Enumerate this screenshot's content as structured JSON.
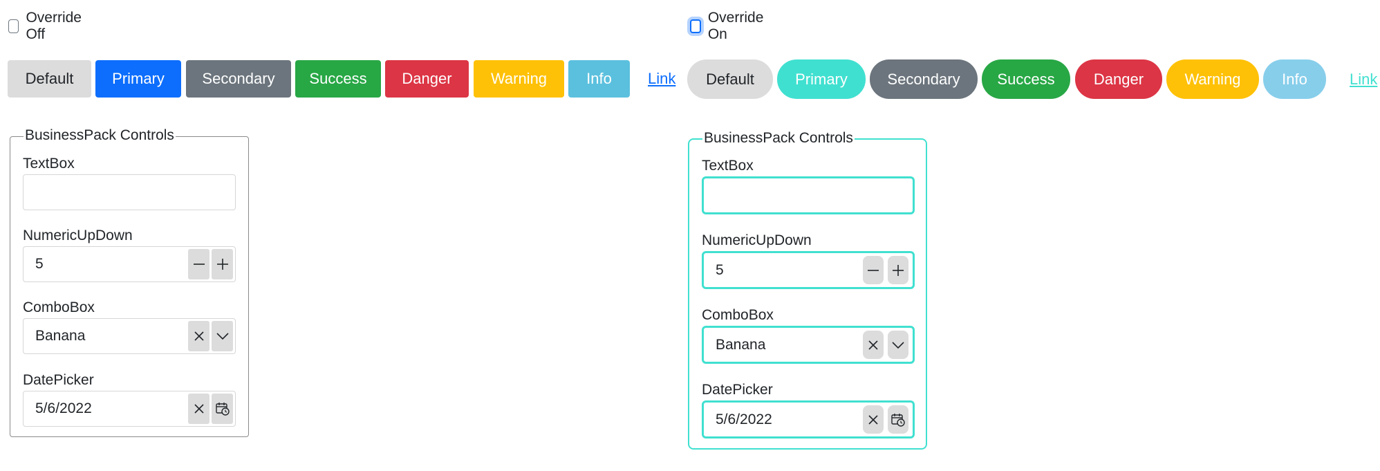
{
  "colors": {
    "default": "#dcdcdc",
    "primary": "#0d6efd",
    "primary_override": "#40e0d0",
    "secondary": "#6c757d",
    "success": "#28a745",
    "danger": "#dc3545",
    "warning": "#ffc107",
    "info": "#5bc0de",
    "info_override": "#87ceeb",
    "link": "#0d6efd",
    "link_override": "#40e0d0",
    "accent_override": "#40e0d0"
  },
  "off": {
    "checkbox_label": "Override Off",
    "buttons": {
      "default": "Default",
      "primary": "Primary",
      "secondary": "Secondary",
      "success": "Success",
      "danger": "Danger",
      "warning": "Warning",
      "info": "Info",
      "link": "Link"
    },
    "group": {
      "legend": "BusinessPack Controls",
      "textbox_label": "TextBox",
      "textbox_value": "",
      "numeric_label": "NumericUpDown",
      "numeric_value": "5",
      "combo_label": "ComboBox",
      "combo_value": "Banana",
      "date_label": "DatePicker",
      "date_value": "5/6/2022"
    }
  },
  "on": {
    "checkbox_label": "Override On",
    "buttons": {
      "default": "Default",
      "primary": "Primary",
      "secondary": "Secondary",
      "success": "Success",
      "danger": "Danger",
      "warning": "Warning",
      "info": "Info",
      "link": "Link"
    },
    "group": {
      "legend": "BusinessPack Controls",
      "textbox_label": "TextBox",
      "textbox_value": "",
      "numeric_label": "NumericUpDown",
      "numeric_value": "5",
      "combo_label": "ComboBox",
      "combo_value": "Banana",
      "date_label": "DatePicker",
      "date_value": "5/6/2022"
    }
  },
  "icons": {
    "minus": "minus-icon",
    "plus": "plus-icon",
    "clear": "close-icon",
    "dropdown": "chevron-down-icon",
    "calendar": "calendar-clock-icon"
  }
}
